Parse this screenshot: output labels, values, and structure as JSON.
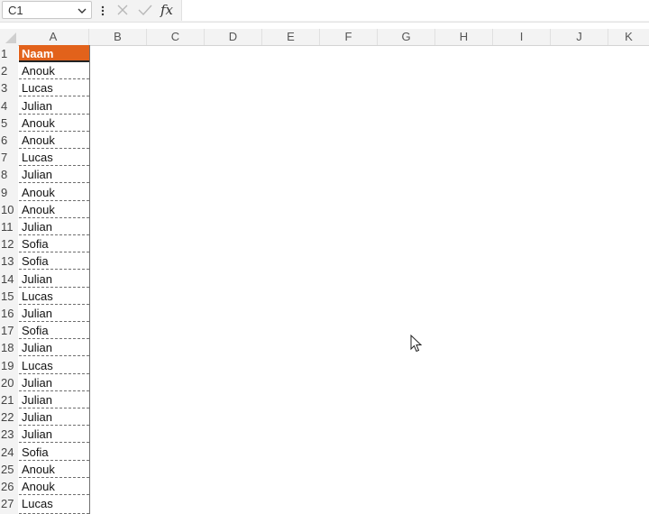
{
  "formula_bar": {
    "name_box": "C1",
    "fx_label": "fx",
    "formula": ""
  },
  "columns": [
    "A",
    "B",
    "C",
    "D",
    "E",
    "F",
    "G",
    "H",
    "I",
    "J",
    "K"
  ],
  "rows": [
    "1",
    "2",
    "3",
    "4",
    "5",
    "6",
    "7",
    "8",
    "9",
    "10",
    "11",
    "12",
    "13",
    "14",
    "15",
    "16",
    "17",
    "18",
    "19",
    "20",
    "21",
    "22",
    "23",
    "24",
    "25",
    "26",
    "27"
  ],
  "sheet": {
    "header": "Naam",
    "names": [
      "Anouk",
      "Lucas",
      "Julian",
      "Anouk",
      "Anouk",
      "Lucas",
      "Julian",
      "Anouk",
      "Anouk",
      "Julian",
      "Sofia",
      "Sofia",
      "Julian",
      "Lucas",
      "Julian",
      "Sofia",
      "Julian",
      "Lucas",
      "Julian",
      "Julian",
      "Julian",
      "Julian",
      "Sofia",
      "Anouk",
      "Anouk",
      "Lucas"
    ]
  },
  "colors": {
    "header_fill": "#e2621b",
    "header_text": "#ffffff"
  }
}
